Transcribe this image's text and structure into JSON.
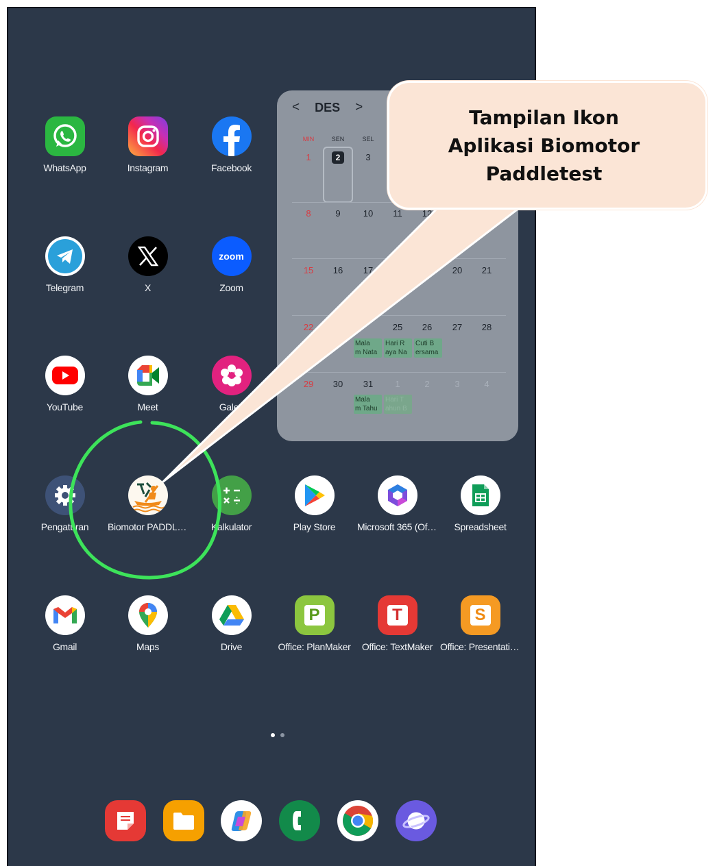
{
  "apps": [
    {
      "label": "WhatsApp",
      "icon": "whatsapp-icon"
    },
    {
      "label": "Instagram",
      "icon": "instagram-icon"
    },
    {
      "label": "Facebook",
      "icon": "facebook-icon"
    },
    {
      "label": "Telegram",
      "icon": "telegram-icon"
    },
    {
      "label": "X",
      "icon": "x-icon"
    },
    {
      "label": "Zoom",
      "icon": "zoom-icon",
      "icon_text": "zoom"
    },
    {
      "label": "YouTube",
      "icon": "youtube-icon"
    },
    {
      "label": "Meet",
      "icon": "meet-icon"
    },
    {
      "label": "Galeri",
      "icon": "gallery-icon"
    },
    {
      "label": "Pengaturan",
      "icon": "settings-gear-icon"
    },
    {
      "label": "Biomotor PADDLE...",
      "icon": "biomotor-paddle-icon"
    },
    {
      "label": "Kalkulator",
      "icon": "calculator-icon"
    },
    {
      "label": "Play Store",
      "icon": "play-store-icon"
    },
    {
      "label": "Microsoft 365 (Offi...",
      "icon": "microsoft-365-icon"
    },
    {
      "label": "Spreadsheet",
      "icon": "spreadsheet-icon"
    },
    {
      "label": "Gmail",
      "icon": "gmail-icon"
    },
    {
      "label": "Maps",
      "icon": "maps-icon"
    },
    {
      "label": "Drive",
      "icon": "drive-icon"
    },
    {
      "label": "Office: PlanMaker",
      "icon": "planmaker-icon",
      "icon_text": "P"
    },
    {
      "label": "Office: TextMaker",
      "icon": "textmaker-icon",
      "icon_text": "T"
    },
    {
      "label": "Office: Presentatio...",
      "icon": "presentations-icon",
      "icon_text": "S"
    }
  ],
  "calendar": {
    "month": "DES",
    "prev": "<",
    "next": ">",
    "weekdays": [
      "MIN",
      "SEN",
      "SEL"
    ],
    "today": "2",
    "weeks": [
      [
        "1",
        "",
        "3"
      ],
      [
        "8",
        "9",
        "10",
        "11",
        "12"
      ],
      [
        "15",
        "16",
        "17",
        "20",
        "21"
      ],
      [
        "22",
        "25",
        "26",
        "27",
        "28"
      ],
      [
        "29",
        "30",
        "31",
        "1",
        "2",
        "3",
        "4"
      ]
    ],
    "events": [
      "Mala\nm Nata",
      "Hari R\naya Na",
      "Cuti B\nersama",
      "Mala\nm Tahu",
      "Hari T\nahun B"
    ]
  },
  "callout": {
    "text": "Tampilan Ikon Aplikasi Biomotor Paddletest"
  },
  "dock": [
    {
      "icon": "notes-icon"
    },
    {
      "icon": "files-icon"
    },
    {
      "icon": "copilot-icon"
    },
    {
      "icon": "phone-icon"
    },
    {
      "icon": "chrome-icon"
    },
    {
      "icon": "internet-browser-icon"
    }
  ],
  "page_indicator": {
    "pages": 2,
    "current": 1
  },
  "colors": {
    "wallpaper": "#2c3849",
    "callout_fill": "#fbe5d6",
    "highlight_ring": "#3de35a"
  }
}
